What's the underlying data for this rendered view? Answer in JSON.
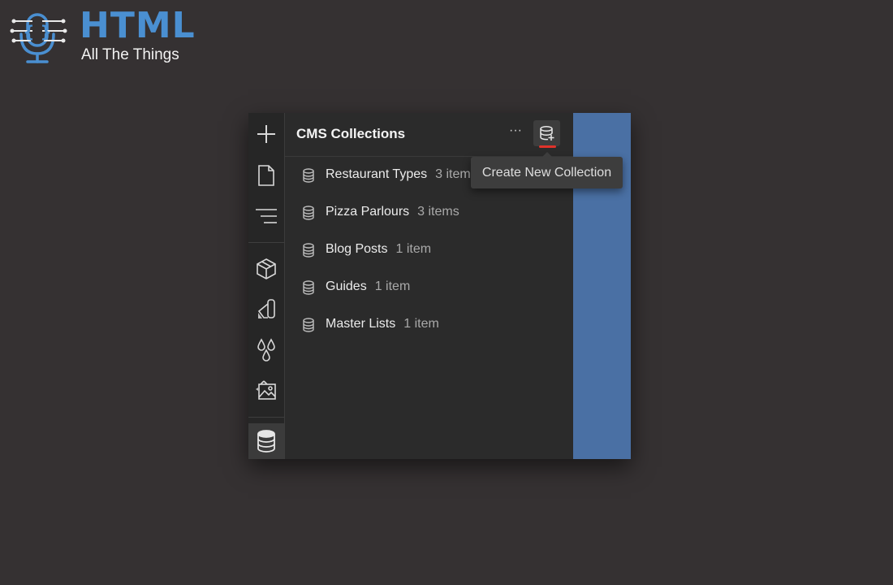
{
  "logo": {
    "word": "HTML",
    "tagline": "All The Things",
    "icon": "microphone-circuit-logo",
    "color": "#4a8fd1"
  },
  "rail": {
    "items": [
      {
        "icon": "plus-icon"
      },
      {
        "icon": "page-icon"
      },
      {
        "icon": "navigator-icon"
      },
      {
        "icon": "cube-icon"
      },
      {
        "icon": "style-manager-icon"
      },
      {
        "icon": "swatches-icon"
      },
      {
        "icon": "image-assets-icon"
      },
      {
        "icon": "database-icon",
        "active": true
      }
    ]
  },
  "panel": {
    "title": "CMS Collections",
    "more_label": "···",
    "new_button_icon": "database-add-icon",
    "accent": "#e0322a"
  },
  "collections": [
    {
      "name": "Restaurant Types",
      "count": "3 items"
    },
    {
      "name": "Pizza Parlours",
      "count": "3 items"
    },
    {
      "name": "Blog Posts",
      "count": "1 item"
    },
    {
      "name": "Guides",
      "count": "1 item"
    },
    {
      "name": "Master Lists",
      "count": "1 item"
    }
  ],
  "tooltip": {
    "text": "Create New Collection"
  },
  "colors": {
    "background": "#353132",
    "panel": "#2b2b2b",
    "rail": "#262626",
    "canvas_blue": "#4a70a4"
  }
}
